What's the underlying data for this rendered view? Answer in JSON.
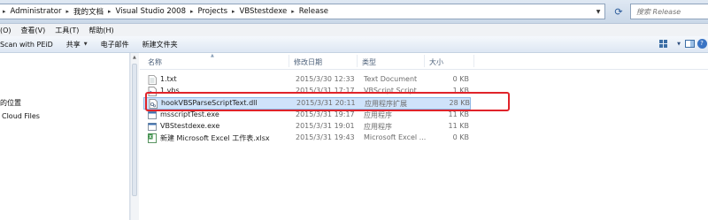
{
  "address": {
    "breadcrumbs": [
      "Administrator",
      "我的文档",
      "Visual Studio 2008",
      "Projects",
      "VBStestdexe",
      "Release"
    ]
  },
  "search": {
    "placeholder": "搜索 Release"
  },
  "menu": [
    "(O)",
    "查看(V)",
    "工具(T)",
    "帮助(H)"
  ],
  "toolbar": {
    "scan_label": "Scan with PEiD",
    "share_label": "共享",
    "email_label": "电子邮件",
    "new_folder_label": "新建文件夹"
  },
  "nav": {
    "items": [
      "的位置",
      "Cloud Files"
    ]
  },
  "columns": {
    "name": "名称",
    "date": "修改日期",
    "type": "类型",
    "size": "大小"
  },
  "files": [
    {
      "name": "1.txt",
      "date": "2015/3/30 12:33",
      "type": "Text Document",
      "size": "0 KB",
      "icon": "text-file-icon"
    },
    {
      "name": "1.vbs",
      "date": "2015/3/31 17:17",
      "type": "VBScript Script ...",
      "size": "1 KB",
      "icon": "script-file-icon"
    },
    {
      "name": "hookVBSParseScriptText.dll",
      "date": "2015/3/31 20:11",
      "type": "应用程序扩展",
      "size": "28 KB",
      "icon": "dll-file-icon"
    },
    {
      "name": "msscriptTest.exe",
      "date": "2015/3/31 19:17",
      "type": "应用程序",
      "size": "11 KB",
      "icon": "exe-file-icon"
    },
    {
      "name": "VBStestdexe.exe",
      "date": "2015/3/31 19:01",
      "type": "应用程序",
      "size": "11 KB",
      "icon": "exe-file-icon"
    },
    {
      "name": "新建 Microsoft Excel 工作表.xlsx",
      "date": "2015/3/31 19:43",
      "type": "Microsoft Excel ...",
      "size": "0 KB",
      "icon": "excel-file-icon"
    }
  ],
  "colors": {
    "selection": "#cfe3fa",
    "highlight": "#e0232a",
    "header_text": "#4c607a"
  }
}
